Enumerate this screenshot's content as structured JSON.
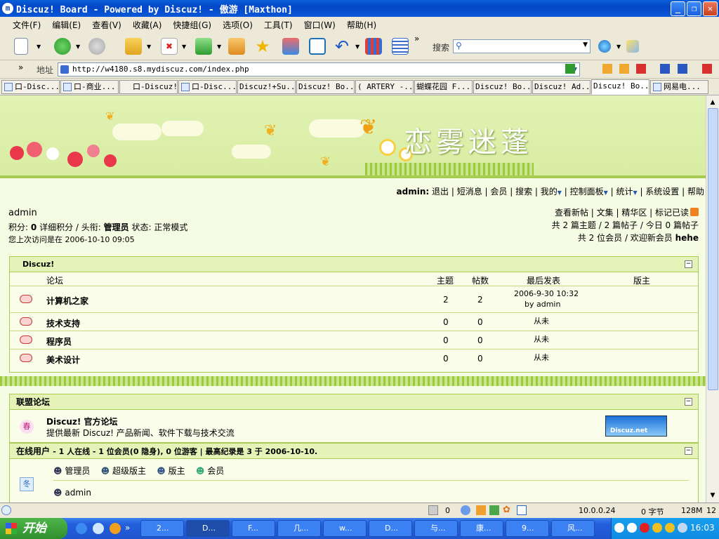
{
  "window": {
    "title": "Discuz! Board - Powered by Discuz! - 傲游 [Maxthon]"
  },
  "menu": [
    "文件(F)",
    "编辑(E)",
    "查看(V)",
    "收藏(A)",
    "快捷组(G)",
    "选项(O)",
    "工具(T)",
    "窗口(W)",
    "帮助(H)"
  ],
  "toolbar": {
    "search_label": "搜索"
  },
  "address": {
    "label": "地址",
    "url": "http://w4180.s8.mydiscuz.com/index.php"
  },
  "tabs": [
    "口-Disc...",
    "口-商业...",
    "口-Discuz!...",
    "口-Disc...",
    "Discuz!+Su...",
    "Discuz! Bo...",
    "( ARTERY -...",
    "蝴蝶花园 F...",
    "Discuz! Bo...",
    "Discuz! Ad...",
    "Discuz! Bo...",
    "网易电..."
  ],
  "banner": {
    "title": "恋雾迷蓬"
  },
  "nav": {
    "user": "admin:",
    "links": [
      "退出",
      "短消息",
      "会员",
      "搜索",
      "我的",
      "控制面板",
      "统计",
      "系统设置",
      "帮助"
    ]
  },
  "user": {
    "name": "admin",
    "score_prefix": "积分:",
    "score": "0",
    "detail": "详细积分 / 头衔:",
    "title": "管理员",
    "status_label": "状态:",
    "status": "正常模式",
    "last_visit": "您上次访问是在 2006-10-10 09:05"
  },
  "right_info": {
    "links": "查看新帖 | 文集 | 精华区 | 标记已读",
    "stats": "共 2 篇主题 / 2 篇帖子 / 今日 0 篇帖子",
    "members": "共 2 位会员 / 欢迎新会员",
    "newest": "hehe"
  },
  "forum_box": {
    "title": "Discuz!",
    "columns": {
      "forum": "论坛",
      "topics": "主题",
      "posts": "帖数",
      "last": "最后发表",
      "mod": "版主"
    },
    "rows": [
      {
        "name": "计算机之家",
        "topics": "2",
        "posts": "2",
        "last": "2006-9-30 10:32",
        "by": "by admin"
      },
      {
        "name": "技术支持",
        "topics": "0",
        "posts": "0",
        "last": "从未"
      },
      {
        "name": "程序员",
        "topics": "0",
        "posts": "0",
        "last": "从未"
      },
      {
        "name": "美术设计",
        "topics": "0",
        "posts": "0",
        "last": "从未"
      }
    ]
  },
  "league": {
    "title": "联盟论坛",
    "icon_char": "春",
    "name": "Discuz! 官方论坛",
    "desc": "提供最新 Discuz! 产品新闻、软件下载与技术交流",
    "logo": "Discuz.net"
  },
  "online": {
    "title": "在线用户",
    "summary": "- 1 人在线 - 1 位会员(0 隐身), 0 位游客 | 最高纪录是 3 于 2006-10-10.",
    "icon_char": "冬",
    "legend": [
      "管理员",
      "超级版主",
      "版主",
      "会员"
    ],
    "users": [
      "admin"
    ]
  },
  "status": {
    "count": "0",
    "ip": "10.0.0.24",
    "bytes": "0 字节",
    "mem": "128M",
    "extra": "12"
  },
  "taskbar": {
    "start": "开始",
    "tasks": [
      "2...",
      "D...",
      "F...",
      "几...",
      "w...",
      "D...",
      "与...",
      "康...",
      "9...",
      "风..."
    ],
    "clock": "16:03"
  }
}
